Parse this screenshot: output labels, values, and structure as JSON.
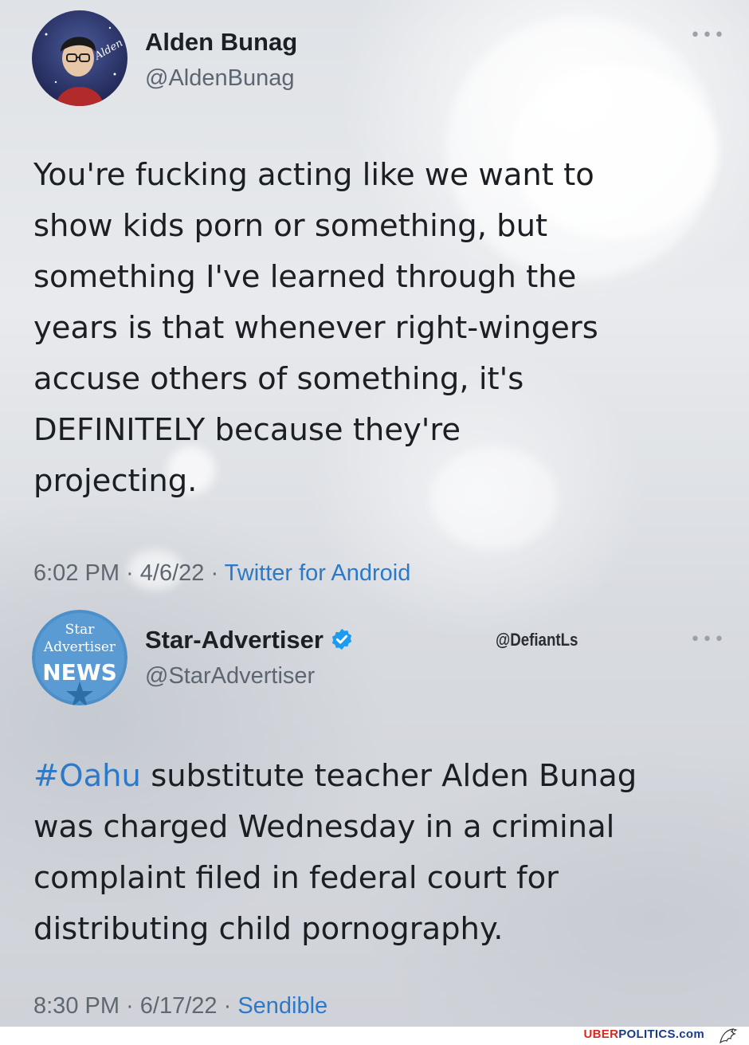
{
  "tweet1": {
    "name": "Alden Bunag",
    "handle": "@AldenBunag",
    "avatar_text": "Alden",
    "text_lines": [
      "You're fucking acting like we want to",
      "show kids porn or something, but",
      "something I've learned through the",
      "years is that whenever right-wingers",
      "accuse others of something, it's",
      "DEFINITELY because they're",
      "projecting."
    ],
    "time": "6:02 PM · 4/6/22 · ",
    "source": "Twitter for Android",
    "more_icon": "more-dots-icon"
  },
  "tweet2": {
    "name": "Star-Advertiser",
    "handle": "@StarAdvertiser",
    "logo_line1": "Star",
    "logo_line2": "Advertiser",
    "logo_line3": "NEWS",
    "watermark_user": "@DefiantLs",
    "hashtag": "#Oahu",
    "text_line1_rest": " substitute teacher Alden Bunag",
    "text_lines": [
      "was charged Wednesday in a criminal",
      "complaint filed in federal court for",
      "distributing child pornography."
    ],
    "time": "8:30 PM · 6/17/22 · ",
    "source": "Sendible",
    "more_icon": "more-dots-icon"
  },
  "footer": {
    "brand_part1": "UBER",
    "brand_part2": "POLITICS.com"
  },
  "colors": {
    "link": "#2c79c9",
    "verified": "#1d9bf0",
    "brand_red": "#d6281f",
    "brand_blue": "#1a3b8c"
  }
}
